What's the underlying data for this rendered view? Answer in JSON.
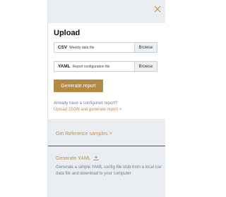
{
  "close_icon": "close-icon",
  "upload": {
    "title": "Upload",
    "csv": {
      "code": "CSV",
      "desc": "Weekly data file",
      "browse": "Browse"
    },
    "yaml": {
      "code": "YAML",
      "desc": "Report configuration file",
      "browse": "Browse"
    },
    "generate_button": "Generate report",
    "question": "Already have a configured report?",
    "json_link": "Upload JSON and generate report >"
  },
  "reference_link": "Get Reference samples >",
  "generate_yaml": {
    "title": "Generate YAML",
    "icon": "download-icon",
    "description": "Generate a simple YAML config file stub from a local csv data file and download to your computer"
  },
  "colors": {
    "accent": "#b48944",
    "link": "#c6914e",
    "panel": "#e9edf2",
    "muted_text": "#6f7f8f"
  }
}
